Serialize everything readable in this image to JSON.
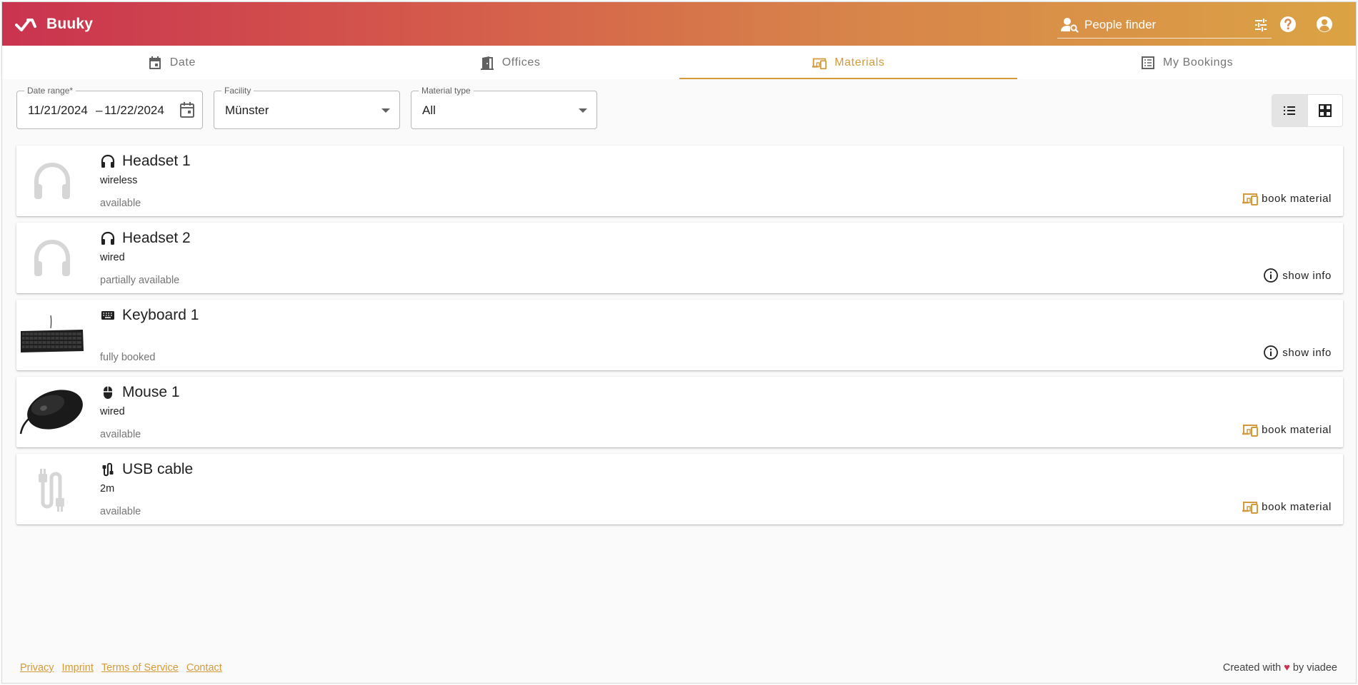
{
  "app": {
    "name": "Buuky"
  },
  "header": {
    "finder_placeholder": "People finder"
  },
  "tabs": [
    {
      "label": "Date",
      "icon": "calendar-icon",
      "active": false
    },
    {
      "label": "Offices",
      "icon": "office-door-icon",
      "active": false
    },
    {
      "label": "Materials",
      "icon": "devices-icon",
      "active": true
    },
    {
      "label": "My Bookings",
      "icon": "list-icon",
      "active": false
    }
  ],
  "filters": {
    "date_range": {
      "label": "Date range*",
      "start": "11/21/2024",
      "separator": "–",
      "end": "11/22/2024"
    },
    "facility": {
      "label": "Facility",
      "value": "Münster"
    },
    "material_type": {
      "label": "Material type",
      "value": "All"
    }
  },
  "view_mode": {
    "selected": "list"
  },
  "materials": [
    {
      "name": "Headset 1",
      "icon": "headset-icon",
      "description": "wireless",
      "status": "available",
      "action": "book material",
      "action_icon": "devices-icon",
      "image": "headset-placeholder"
    },
    {
      "name": "Headset 2",
      "icon": "headset-icon",
      "description": "wired",
      "status": "partially available",
      "action": "show info",
      "action_icon": "info-icon",
      "image": "headset-placeholder"
    },
    {
      "name": "Keyboard 1",
      "icon": "keyboard-icon",
      "description": "",
      "status": "fully booked",
      "action": "show info",
      "action_icon": "info-icon",
      "image": "keyboard-photo"
    },
    {
      "name": "Mouse 1",
      "icon": "mouse-icon",
      "description": "wired",
      "status": "available",
      "action": "book material",
      "action_icon": "devices-icon",
      "image": "mouse-photo"
    },
    {
      "name": "USB cable",
      "icon": "cable-icon",
      "description": "2m",
      "status": "available",
      "action": "book material",
      "action_icon": "devices-icon",
      "image": "cable-placeholder"
    }
  ],
  "footer": {
    "links": [
      "Privacy",
      "Imprint",
      "Terms of Service",
      "Contact"
    ],
    "credit_prefix": "Created with",
    "credit_heart": "♥",
    "credit_suffix": "by viadee"
  },
  "colors": {
    "accent": "#d49a3a",
    "brand_start": "#c9334f",
    "brand_end": "#dba344"
  }
}
